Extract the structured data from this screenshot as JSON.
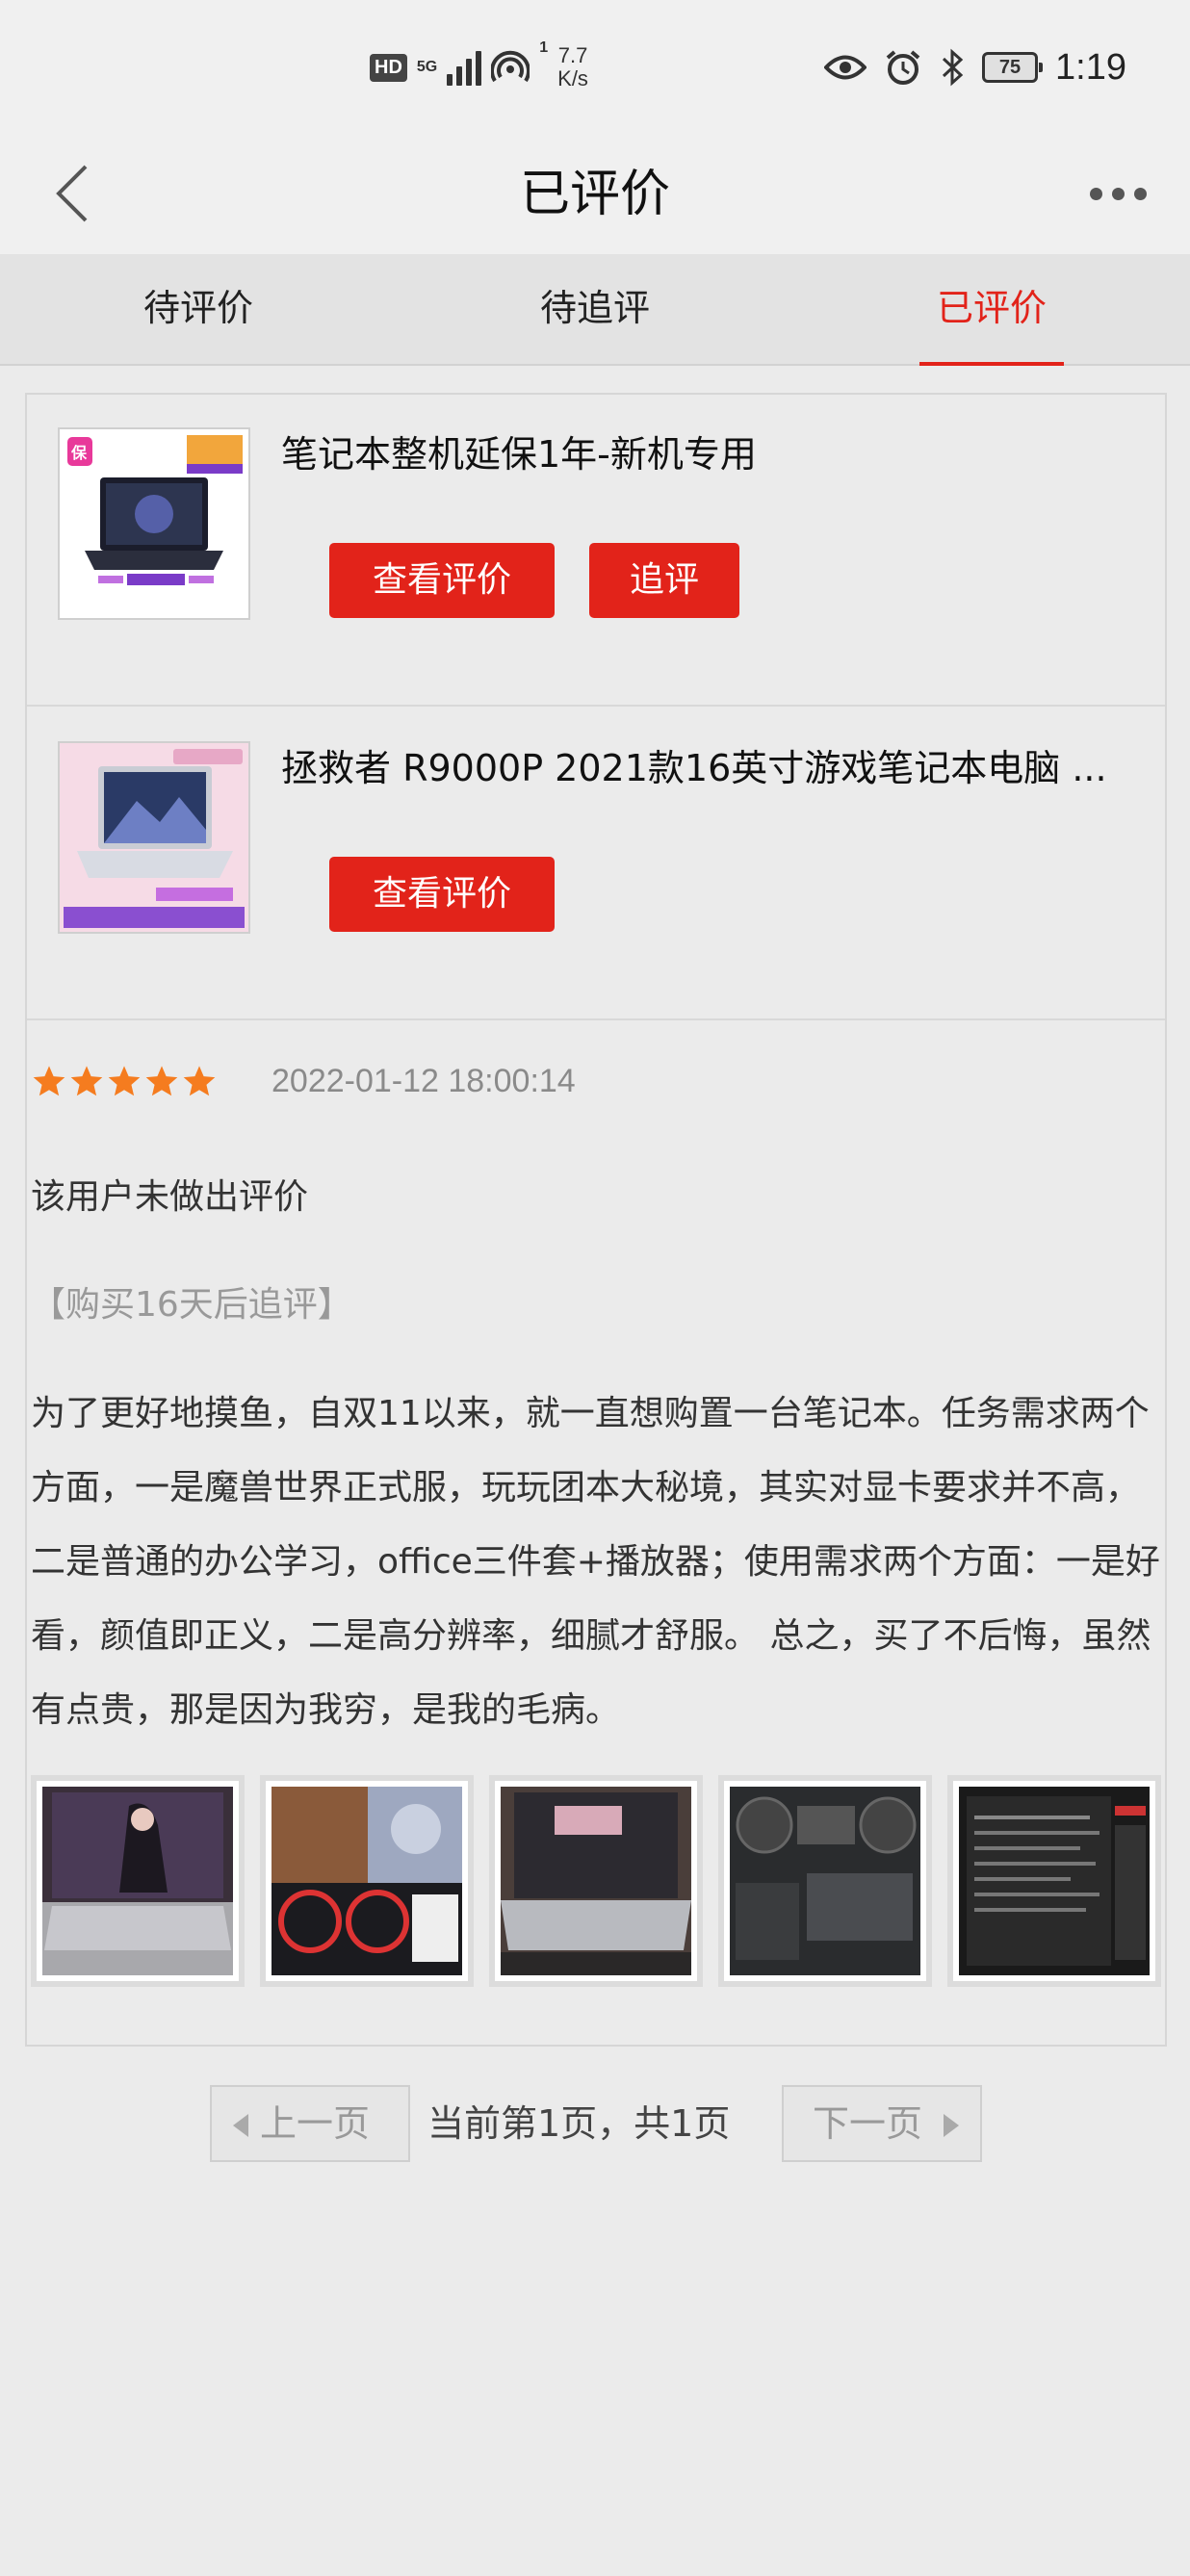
{
  "status_bar": {
    "hd": "HD",
    "network": "5G",
    "hotspot_count": "1",
    "speed_value": "7.7",
    "speed_unit": "K/s",
    "battery": "75",
    "time": "1:19"
  },
  "nav": {
    "title": "已评价"
  },
  "tabs": [
    {
      "label": "待评价",
      "active": false
    },
    {
      "label": "待追评",
      "active": false
    },
    {
      "label": "已评价",
      "active": true
    }
  ],
  "products": [
    {
      "name": "笔记本整机延保1年-新机专用",
      "thumb_tag": "保",
      "view_label": "查看评价",
      "follow_label": "追评"
    },
    {
      "name": "拯救者 R9000P 2021款16英寸游戏笔记本电脑 ...",
      "view_label": "查看评价"
    }
  ],
  "review": {
    "rating": 5,
    "date": "2022-01-12 18:00:14",
    "initial_comment": "该用户未做出评价",
    "followup_tag": "【购买16天后追评】",
    "followup_text": "为了更好地摸鱼，自双11以来，就一直想购置一台笔记本。任务需求两个方面，一是魔兽世界正式服，玩玩团本大秘境，其实对显卡要求并不高，二是普通的办公学习，office三件套+播放器；使用需求两个方面：一是好看，颜值即正义，二是高分辨率，细腻才舒服。 总之，买了不后悔，虽然有点贵，那是因为我穷，是我的毛病。",
    "photo_count": 5
  },
  "pager": {
    "prev_label": "上一页",
    "info": "当前第1页，共1页",
    "next_label": "下一页"
  },
  "colors": {
    "accent": "#e2231a",
    "star": "#f57c1f",
    "background": "#ebebeb"
  }
}
